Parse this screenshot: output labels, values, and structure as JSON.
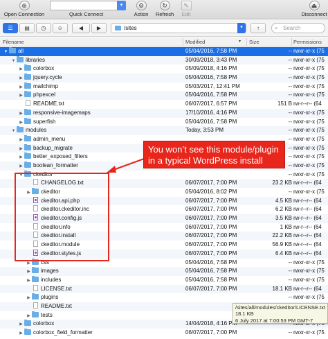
{
  "toolbar": {
    "open_connection": "Open Connection",
    "quick_connect": "Quick Connect",
    "action": "Action",
    "refresh": "Refresh",
    "edit": "Edit",
    "disconnect": "Disconnect"
  },
  "pathbar": {
    "path": "/sites",
    "search_placeholder": "Search"
  },
  "columns": {
    "filename": "Filename",
    "modified": "Modified",
    "size": "Size",
    "permissions": "Permissions"
  },
  "rows": [
    {
      "indent": 0,
      "disc": "down",
      "kind": "folder",
      "name": "all",
      "modified": "05/04/2016, 7:58 PM",
      "size": "--",
      "perm": "rwxr-xr-x (75",
      "state": "sel"
    },
    {
      "indent": 1,
      "disc": "down",
      "kind": "folder",
      "name": "libraries",
      "modified": "30/09/2018, 3:43 PM",
      "size": "--",
      "perm": "rwxr-xr-x (75"
    },
    {
      "indent": 2,
      "disc": "right",
      "kind": "folder",
      "name": "colorbox",
      "modified": "05/09/2018, 4:16 PM",
      "size": "--",
      "perm": "rwxr-xr-x (75"
    },
    {
      "indent": 2,
      "disc": "right",
      "kind": "folder",
      "name": "jquery.cycle",
      "modified": "05/04/2016, 7:58 PM",
      "size": "--",
      "perm": "rwxr-xr-x (75"
    },
    {
      "indent": 2,
      "disc": "right",
      "kind": "folder",
      "name": "mailchimp",
      "modified": "05/03/2017, 12:41 PM",
      "size": "--",
      "perm": "rwxr-xr-x (75"
    },
    {
      "indent": 2,
      "disc": "right",
      "kind": "folder",
      "name": "phpexcel",
      "modified": "05/04/2016, 7:58 PM",
      "size": "--",
      "perm": "rwxr-xr-x (75"
    },
    {
      "indent": 2,
      "disc": "",
      "kind": "file",
      "name": "README.txt",
      "modified": "06/07/2017, 6:57 PM",
      "size": "151 B",
      "perm": "rw-r--r-- (64"
    },
    {
      "indent": 2,
      "disc": "right",
      "kind": "folder",
      "name": "responsive-imagemaps",
      "modified": "17/10/2016, 4:16 PM",
      "size": "--",
      "perm": "rwxr-xr-x (75"
    },
    {
      "indent": 2,
      "disc": "right",
      "kind": "folder",
      "name": "superfish",
      "modified": "05/04/2016, 7:58 PM",
      "size": "--",
      "perm": "rwxr-xr-x (75"
    },
    {
      "indent": 1,
      "disc": "down",
      "kind": "folder",
      "name": "modules",
      "modified": "Today, 3:53 PM",
      "size": "--",
      "perm": "rwxr-xr-x (75"
    },
    {
      "indent": 2,
      "disc": "right",
      "kind": "folder",
      "name": "admin_menu",
      "modified": "",
      "size": "--",
      "perm": "rwxr-xr-x (75"
    },
    {
      "indent": 2,
      "disc": "right",
      "kind": "folder",
      "name": "backup_migrate",
      "modified": "",
      "size": "--",
      "perm": "rwxr-xr-x (75"
    },
    {
      "indent": 2,
      "disc": "right",
      "kind": "folder",
      "name": "better_exposed_filters",
      "modified": "",
      "size": "--",
      "perm": "rwxr-xr-x (75"
    },
    {
      "indent": 2,
      "disc": "right",
      "kind": "folder",
      "name": "boolean_formatter",
      "modified": "",
      "size": "--",
      "perm": "rwxr-xr-x (75"
    },
    {
      "indent": 2,
      "disc": "down",
      "kind": "folder",
      "name": "ckeditor",
      "modified": "",
      "size": "--",
      "perm": "rwxr-xr-x (75"
    },
    {
      "indent": 3,
      "disc": "",
      "kind": "file",
      "name": "CHANGELOG.txt",
      "modified": "06/07/2017, 7:00 PM",
      "size": "23.2 KB",
      "perm": "rw-r--r-- (64"
    },
    {
      "indent": 3,
      "disc": "right",
      "kind": "folder",
      "name": "ckeditor",
      "modified": "05/04/2016, 8:02 PM",
      "size": "--",
      "perm": "rwxr-xr-x (75"
    },
    {
      "indent": 3,
      "disc": "",
      "kind": "php",
      "name": "ckeditor.api.php",
      "modified": "06/07/2017, 7:00 PM",
      "size": "4.5 KB",
      "perm": "rw-r--r-- (64"
    },
    {
      "indent": 3,
      "disc": "",
      "kind": "file",
      "name": "ckeditor.ckeditor.inc",
      "modified": "06/07/2017, 7:00 PM",
      "size": "6.2 KB",
      "perm": "rw-r--r-- (64"
    },
    {
      "indent": 3,
      "disc": "",
      "kind": "php",
      "name": "ckeditor.config.js",
      "modified": "06/07/2017, 7:00 PM",
      "size": "3.5 KB",
      "perm": "rw-r--r-- (64"
    },
    {
      "indent": 3,
      "disc": "",
      "kind": "file",
      "name": "ckeditor.info",
      "modified": "06/07/2017, 7:00 PM",
      "size": "1 KB",
      "perm": "rw-r--r-- (64"
    },
    {
      "indent": 3,
      "disc": "",
      "kind": "file",
      "name": "ckeditor.install",
      "modified": "06/07/2017, 7:00 PM",
      "size": "22.2 KB",
      "perm": "rw-r--r-- (64"
    },
    {
      "indent": 3,
      "disc": "",
      "kind": "file",
      "name": "ckeditor.module",
      "modified": "06/07/2017, 7:00 PM",
      "size": "56.9 KB",
      "perm": "rw-r--r-- (64"
    },
    {
      "indent": 3,
      "disc": "",
      "kind": "php",
      "name": "ckeditor.styles.js",
      "modified": "06/07/2017, 7:00 PM",
      "size": "6.4 KB",
      "perm": "rw-r--r-- (64"
    },
    {
      "indent": 3,
      "disc": "right",
      "kind": "folder",
      "name": "css",
      "modified": "05/04/2016, 7:58 PM",
      "size": "--",
      "perm": "rwxr-xr-x (75"
    },
    {
      "indent": 3,
      "disc": "right",
      "kind": "folder",
      "name": "images",
      "modified": "05/04/2016, 7:58 PM",
      "size": "--",
      "perm": "rwxr-xr-x (75"
    },
    {
      "indent": 3,
      "disc": "right",
      "kind": "folder",
      "name": "includes",
      "modified": "05/04/2016, 7:58 PM",
      "size": "--",
      "perm": "rwxr-xr-x (75"
    },
    {
      "indent": 3,
      "disc": "",
      "kind": "file",
      "name": "LICENSE.txt",
      "modified": "06/07/2017, 7:00 PM",
      "size": "18.1 KB",
      "perm": "rw-r--r-- (64"
    },
    {
      "indent": 3,
      "disc": "right",
      "kind": "folder",
      "name": "plugins",
      "modified": "",
      "size": "--",
      "perm": "rwxr-xr-x (75"
    },
    {
      "indent": 3,
      "disc": "",
      "kind": "file",
      "name": "README.txt",
      "modified": "",
      "size": "",
      "perm": "rw-r--r-- (64"
    },
    {
      "indent": 3,
      "disc": "right",
      "kind": "folder",
      "name": "tests",
      "modified": "",
      "size": "",
      "perm": "rwxr-xr-x (75"
    },
    {
      "indent": 2,
      "disc": "right",
      "kind": "folder",
      "name": "colorbox",
      "modified": "14/04/2018, 4:16 PM",
      "size": "--",
      "perm": "rwxr-xr-x (75"
    },
    {
      "indent": 2,
      "disc": "right",
      "kind": "folder",
      "name": "colorbox_field_formatter",
      "modified": "06/07/2017, 7:00 PM",
      "size": "--",
      "perm": "rwxr-xr-x (75"
    }
  ],
  "callout": {
    "line1": "You won’t see this module/plugin",
    "line2": "in a typical WordPress install"
  },
  "tooltip": {
    "line1": "/sites/all/modules/ckeditor/LICENSE.txt",
    "line2": "18.1 KB",
    "line3": "6 July 2017 at 7:00:53 PM GMT-7"
  },
  "colors": {
    "selection": "#1a6ee6",
    "folder": "#6aaee8",
    "callout": "#e8261c"
  }
}
